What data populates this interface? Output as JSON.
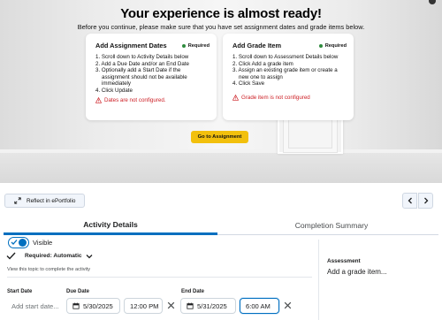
{
  "hero": {
    "title": "Your experience is almost ready!",
    "subtitle": "Before you continue, please make sure that you have set assignment dates and grade items below.",
    "cards": [
      {
        "title": "Add Assignment Dates",
        "badge": "Required",
        "steps": [
          "1. Scroll down to Activity Details below",
          "2. Add a Due Date and/or an End Date",
          "3. Optionally add a Start Date if the",
          "assignment should not be available",
          "immediately",
          "4. Click Update"
        ],
        "warning": "Dates are not configured."
      },
      {
        "title": "Add Grade Item",
        "badge": "Required",
        "steps": [
          "1. Scroll down to Assessment Details below",
          "2. Click Add a grade item",
          "3. Assign an existing grade item or create a",
          "new one to assign",
          "4. Click Save"
        ],
        "warning": "Grade item is not configured"
      }
    ],
    "cta_label": "Go to Assignment"
  },
  "toolbar": {
    "reflect_label": "Reflect in ePortfolio"
  },
  "tabs": [
    {
      "label": "Activity Details",
      "active": true
    },
    {
      "label": "Completion Summary",
      "active": false
    }
  ],
  "activity": {
    "visible_label": "Visible",
    "required_label": "Required: Automatic",
    "hint": "View this topic to complete the activity",
    "start_date": {
      "label": "Start Date",
      "placeholder": "Add start date..."
    },
    "due_date": {
      "label": "Due Date",
      "date": "5/30/2025",
      "time": "12:00 PM"
    },
    "end_date": {
      "label": "End Date",
      "date": "5/31/2025",
      "time": "6:00 AM"
    }
  },
  "assessment": {
    "label": "Assessment",
    "link": "Add a grade item..."
  },
  "colors": {
    "accent": "#006fbf",
    "cta": "#f2c00d",
    "warning": "#cd2026",
    "required_dot": "#2e8b3d"
  },
  "icons": [
    "warning-icon",
    "calendar-icon",
    "close-icon",
    "chevron-left-icon",
    "chevron-right-icon",
    "chevron-down-icon",
    "checkmark-icon",
    "eportfolio-icon"
  ]
}
